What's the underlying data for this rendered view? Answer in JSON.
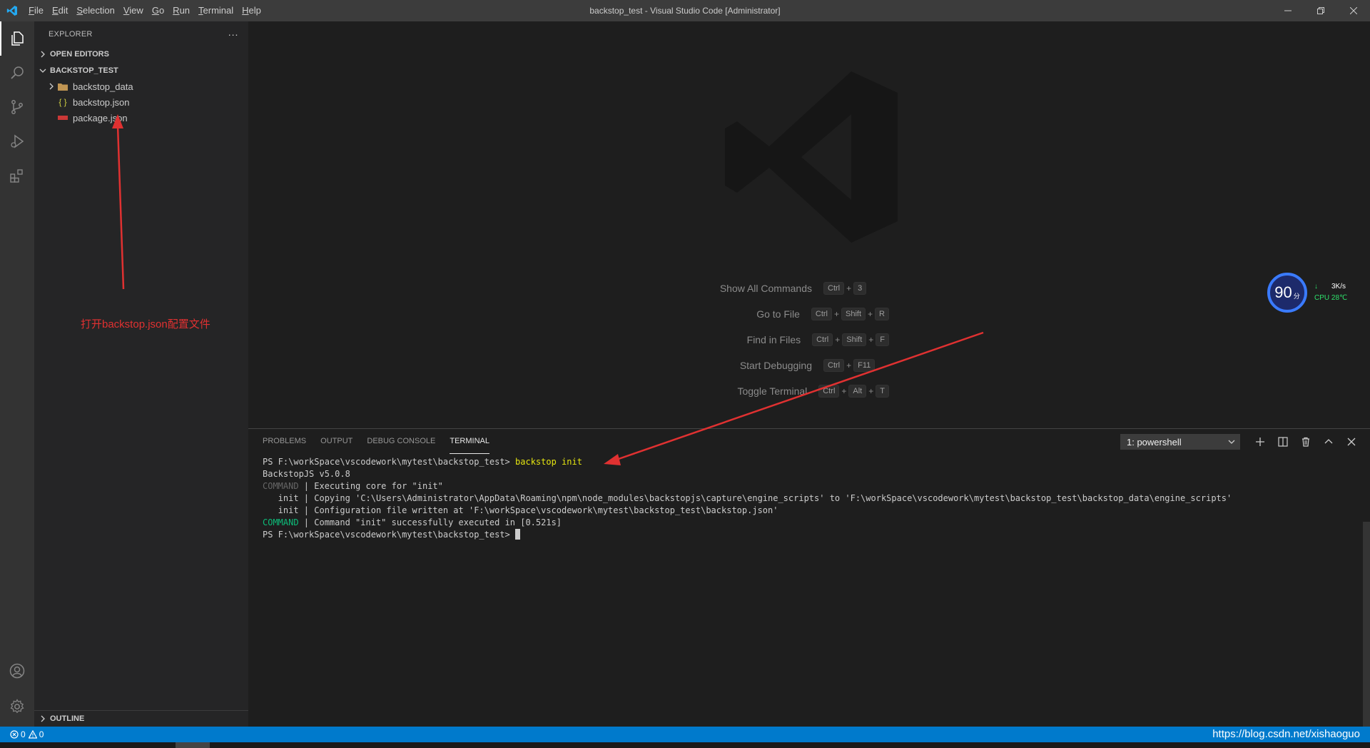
{
  "window": {
    "title": "backstop_test - Visual Studio Code [Administrator]"
  },
  "menu": [
    "File",
    "Edit",
    "Selection",
    "View",
    "Go",
    "Run",
    "Terminal",
    "Help"
  ],
  "sidebar": {
    "title": "EXPLORER",
    "more_label": "···",
    "open_editors": "OPEN EDITORS",
    "folder": "BACKSTOP_TEST",
    "items": [
      {
        "label": "backstop_data",
        "icon": "folder-icon"
      },
      {
        "label": "backstop.json",
        "icon": "json-file-icon"
      },
      {
        "label": "package.json",
        "icon": "npm-file-icon"
      }
    ],
    "outline": "OUTLINE"
  },
  "annotation": {
    "text": "打开backstop.json配置文件"
  },
  "welcome": {
    "shortcuts": [
      {
        "label": "Show All Commands",
        "keys": [
          "Ctrl",
          "3"
        ]
      },
      {
        "label": "Go to File",
        "keys": [
          "Ctrl",
          "Shift",
          "R"
        ]
      },
      {
        "label": "Find in Files",
        "keys": [
          "Ctrl",
          "Shift",
          "F"
        ]
      },
      {
        "label": "Start Debugging",
        "keys": [
          "Ctrl",
          "F11"
        ]
      },
      {
        "label": "Toggle Terminal",
        "keys": [
          "Ctrl",
          "Alt",
          "T"
        ]
      }
    ]
  },
  "panel": {
    "tabs": [
      "PROBLEMS",
      "OUTPUT",
      "DEBUG CONSOLE",
      "TERMINAL"
    ],
    "active_tab": "TERMINAL",
    "terminal_select": "1: powershell",
    "lines": {
      "l1_prompt": "PS F:\\workSpace\\vscodework\\mytest\\backstop_test> ",
      "l1_cmd": "backstop init",
      "l2": "BackstopJS v5.0.8",
      "l3_tag": "COMMAND",
      "l3_text": " | Executing core for \"init\"",
      "l4": "   init | Copying 'C:\\Users\\Administrator\\AppData\\Roaming\\npm\\node_modules\\backstopjs\\capture\\engine_scripts' to 'F:\\workSpace\\vscodework\\mytest\\backstop_test\\backstop_data\\engine_scripts'",
      "l5": "   init | Configuration file written at 'F:\\workSpace\\vscodework\\mytest\\backstop_test\\backstop.json'",
      "l6_tag": "COMMAND",
      "l6_text": " | Command \"init\" successfully executed in [0.521s]",
      "l7_prompt": "PS F:\\workSpace\\vscodework\\mytest\\backstop_test> "
    }
  },
  "status": {
    "errors": "0",
    "warnings": "0",
    "url": "https://blog.csdn.net/xishaoguo"
  },
  "widget": {
    "score": "90",
    "score_unit": "分",
    "speed": "3K/s",
    "cpu": "CPU 28℃"
  },
  "colors": {
    "accent": "#007acc",
    "annotation_red": "#e03131"
  }
}
